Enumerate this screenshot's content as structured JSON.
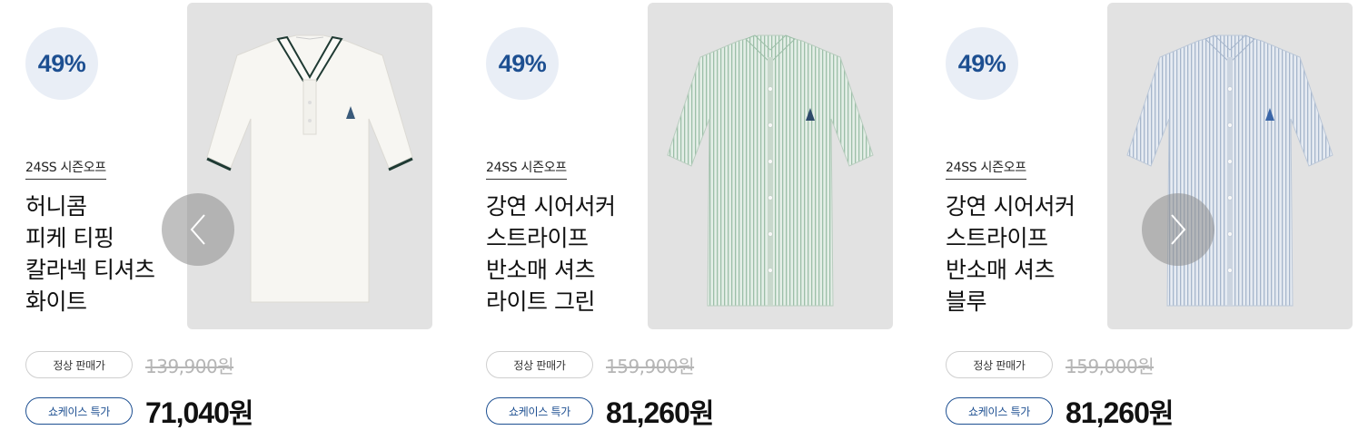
{
  "products": [
    {
      "discount": "49%",
      "season_tag": "24SS 시즌오프",
      "name_lines": [
        "허니콤",
        "피케 티핑",
        "칼라넥 티셔츠",
        "화이트"
      ],
      "regular_label": "정상 판매가",
      "regular_price": "139,900원",
      "special_label": "쇼케이스 특가",
      "special_price": "71,040",
      "special_unit": "원",
      "image_icon": "polo-shirt-white-image",
      "garment_color": "#f7f6f2"
    },
    {
      "discount": "49%",
      "season_tag": "24SS 시즌오프",
      "name_lines": [
        "강연 시어서커",
        "스트라이프",
        "반소매 셔츠",
        "라이트 그린"
      ],
      "regular_label": "정상 판매가",
      "regular_price": "159,900원",
      "special_label": "쇼케이스 특가",
      "special_price": "81,260",
      "special_unit": "원",
      "image_icon": "stripe-shirt-green-image",
      "garment_color": "#dbe7df"
    },
    {
      "discount": "49%",
      "season_tag": "24SS 시즌오프",
      "name_lines": [
        "강연 시어서커",
        "스트라이프",
        "반소매 셔츠",
        "블루"
      ],
      "regular_label": "정상 판매가",
      "regular_price": "159,000원",
      "special_label": "쇼케이스 특가",
      "special_price": "81,260",
      "special_unit": "원",
      "image_icon": "stripe-shirt-blue-image",
      "garment_color": "#dde3ec"
    }
  ],
  "navigation": {
    "prev_icon": "chevron-left-icon",
    "next_icon": "chevron-right-icon"
  },
  "colors": {
    "accent": "#1d4f91",
    "badge_bg": "#e9eef6",
    "image_bg": "#e2e2e2"
  }
}
